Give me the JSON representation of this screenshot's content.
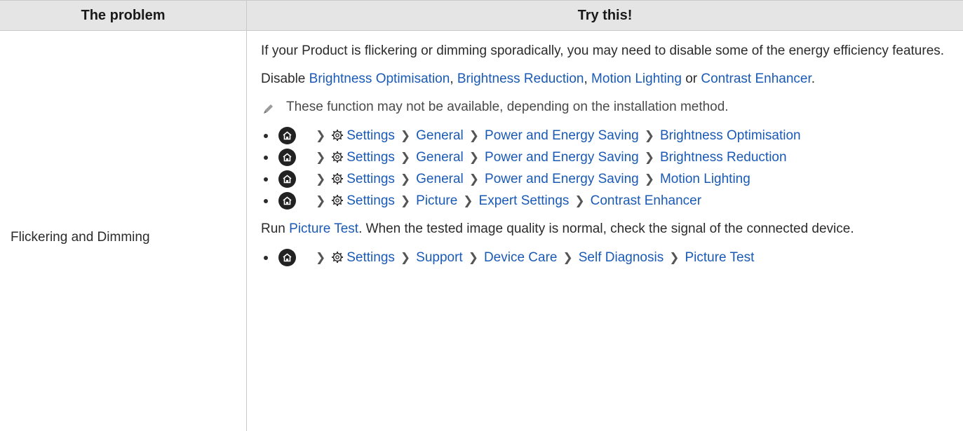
{
  "header": {
    "col_problem": "The problem",
    "col_try": "Try this!"
  },
  "problem": "Flickering and Dimming",
  "paragraph1": "If your Product is flickering or dimming sporadically, you may need to disable some of the energy efficiency features.",
  "paragraph2": {
    "prefix": "Disable ",
    "link1": "Brightness Optimisation",
    "sep1": ", ",
    "link2": "Brightness Reduction",
    "sep2": ", ",
    "link3": "Motion Lighting",
    "sep3": " or ",
    "link4": "Contrast Enhancer",
    "suffix": "."
  },
  "note": "These function may not be available, depending on the installation method.",
  "paths1": [
    [
      "Settings",
      "General",
      "Power and Energy Saving",
      "Brightness Optimisation"
    ],
    [
      "Settings",
      "General",
      "Power and Energy Saving",
      "Brightness Reduction"
    ],
    [
      "Settings",
      "General",
      "Power and Energy Saving",
      "Motion Lighting"
    ],
    [
      "Settings",
      "Picture",
      "Expert Settings",
      "Contrast Enhancer"
    ]
  ],
  "paragraph3": {
    "prefix": "Run ",
    "link": "Picture Test",
    "suffix": ". When the tested image quality is normal, check the signal of the connected device."
  },
  "paths2": [
    [
      "Settings",
      "Support",
      "Device Care",
      "Self Diagnosis",
      "Picture Test"
    ]
  ],
  "icons": {
    "home": "home-icon",
    "settings": "gear-icon",
    "note": "pencil-icon",
    "separator": "chevron-right-icon"
  },
  "colors": {
    "link": "#1a5ab6",
    "header_bg": "#e5e5e5",
    "text": "#2b2b2b"
  }
}
